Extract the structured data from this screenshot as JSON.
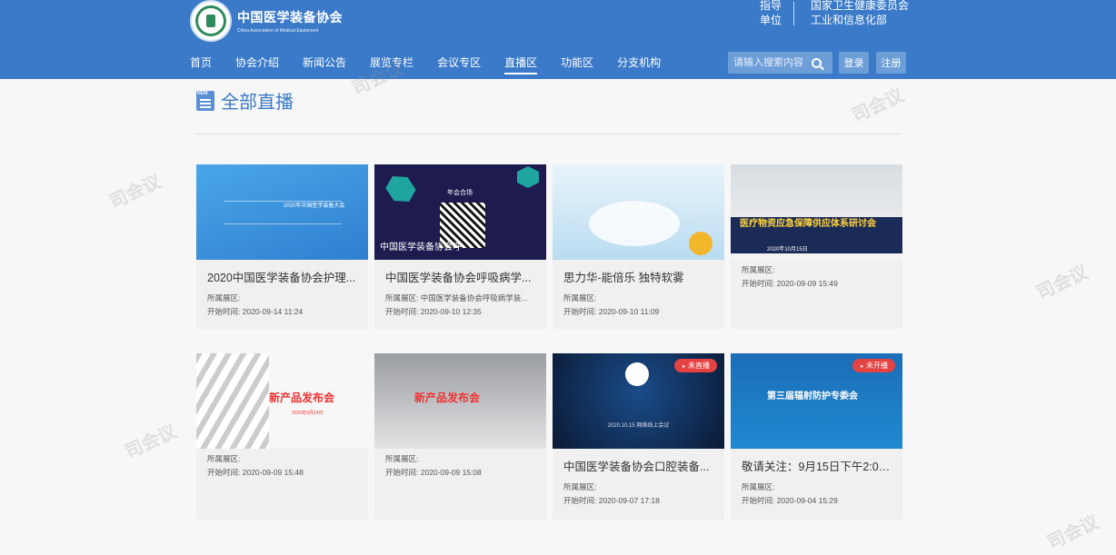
{
  "header": {
    "brand_cn": "中国医学装备协会",
    "brand_en": "China Association of Medical Equipment",
    "guide_label_1": "指导",
    "guide_label_2": "单位",
    "guide_org_1": "国家卫生健康委员会",
    "guide_org_2": "工业和信息化部",
    "nav": [
      {
        "label": "首页"
      },
      {
        "label": "协会介绍"
      },
      {
        "label": "新闻公告"
      },
      {
        "label": "展览专栏"
      },
      {
        "label": "会议专区"
      },
      {
        "label": "直播区",
        "active": true
      },
      {
        "label": "功能区"
      },
      {
        "label": "分支机构"
      }
    ],
    "search_placeholder": "请输入搜索内容",
    "login_label": "登录",
    "register_label": "注册",
    "colors": {
      "header_bg": "#3a7ac9",
      "button_bg": "#6d9ed8"
    }
  },
  "page": {
    "title": "全部直播"
  },
  "cards": [
    {
      "title": "2020中国医学装备协会护理...",
      "hall_label": "所属展区:",
      "hall_value": "",
      "start_label": "开始时间:",
      "start_value": "2020-09-14 11:24",
      "thumb_title": "2020年中国医学装备大会"
    },
    {
      "title": "中国医学装备协会呼吸病学...",
      "hall_label": "所属展区:",
      "hall_value": "中国医学装备协会呼吸病学装...",
      "start_label": "开始时间:",
      "start_value": "2020-09-10 12:35",
      "thumb_title": "年会合场",
      "thumb_caption": "中国医学装备协会呼"
    },
    {
      "title": "思力华-能倍乐 独特软雾",
      "hall_label": "所属展区:",
      "hall_value": "",
      "start_label": "开始时间:",
      "start_value": "2020-09-10 11:09"
    },
    {
      "title": "",
      "hall_label": "所属展区:",
      "hall_value": "",
      "start_label": "开始时间:",
      "start_value": "2020-09-09 15:49",
      "thumb_title": "医疗物资应急保障供应体系研讨会",
      "thumb_date": "2020年10月15日"
    },
    {
      "title": "",
      "hall_label": "所属展区:",
      "hall_value": "",
      "start_label": "开始时间:",
      "start_value": "2020-09-09 15:48",
      "thumb_title": "新产品发布会",
      "thumb_date": "2020年9月24日"
    },
    {
      "title": "",
      "hall_label": "所属展区:",
      "hall_value": "",
      "start_label": "开始时间:",
      "start_value": "2020-09-09 15:08",
      "thumb_title": "新产品发布会"
    },
    {
      "title": "中国医学装备协会口腔装备...",
      "hall_label": "所属展区:",
      "hall_value": "",
      "start_label": "开始时间:",
      "start_value": "2020-09-07 17:18",
      "badge": "未直播",
      "thumb_date": "2020.10.15 网络线上会议"
    },
    {
      "title": "敬请关注：9月15日下午2:00...",
      "hall_label": "所属展区:",
      "hall_value": "",
      "start_label": "开始时间:",
      "start_value": "2020-09-04 15:29",
      "badge": "未开播",
      "thumb_title": "第三届辐射防护专委会"
    }
  ],
  "watermark": "司会议"
}
